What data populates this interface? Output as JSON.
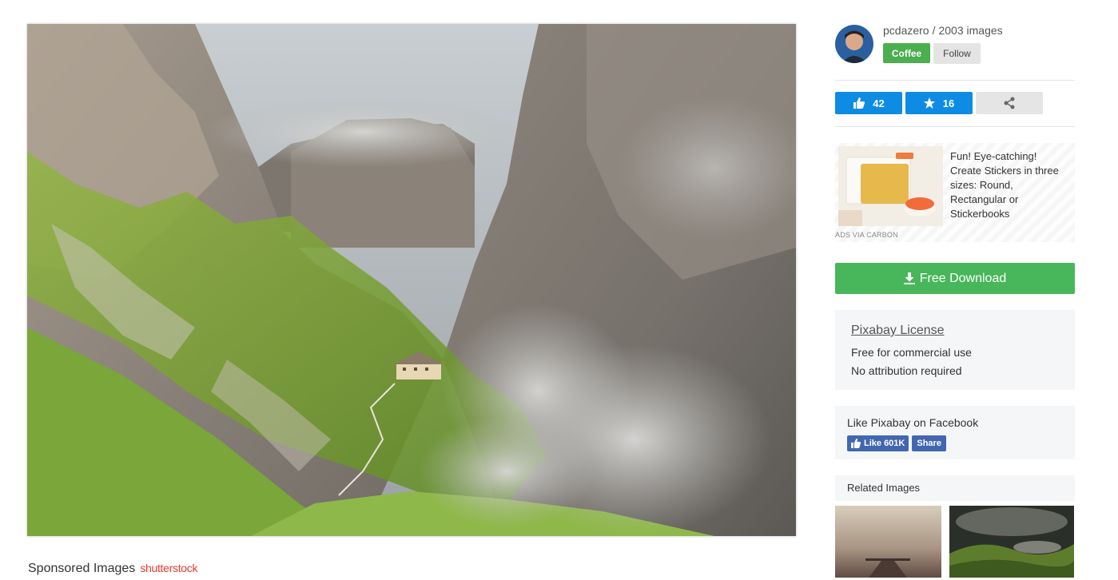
{
  "photo": {
    "alt": ""
  },
  "sponsored": {
    "label": "Sponsored Images",
    "brand": "shutterstock"
  },
  "author": {
    "name": "pcdazero",
    "separator": "/",
    "images": "2003 images",
    "coffee_label": "Coffee",
    "follow_label": "Follow"
  },
  "actions": {
    "likes": "42",
    "favorites": "16"
  },
  "ad": {
    "text": "Fun! Eye-catching! Create Stickers in three sizes: Round, Rectangular or Stickerbooks",
    "via": "ADS VIA CARBON"
  },
  "download": {
    "label": "Free Download"
  },
  "license": {
    "title": "Pixabay License",
    "line1": "Free for commercial use",
    "line2": "No attribution required"
  },
  "facebook": {
    "title": "Like Pixabay on Facebook",
    "like_label": "Like 601K",
    "share_label": "Share"
  },
  "related": {
    "title": "Related Images"
  },
  "colors": {
    "accent_blue": "#0e8ce4",
    "download_green": "#48b65a",
    "coffee_green": "#4bae4f",
    "facebook_blue": "#4267b2"
  }
}
